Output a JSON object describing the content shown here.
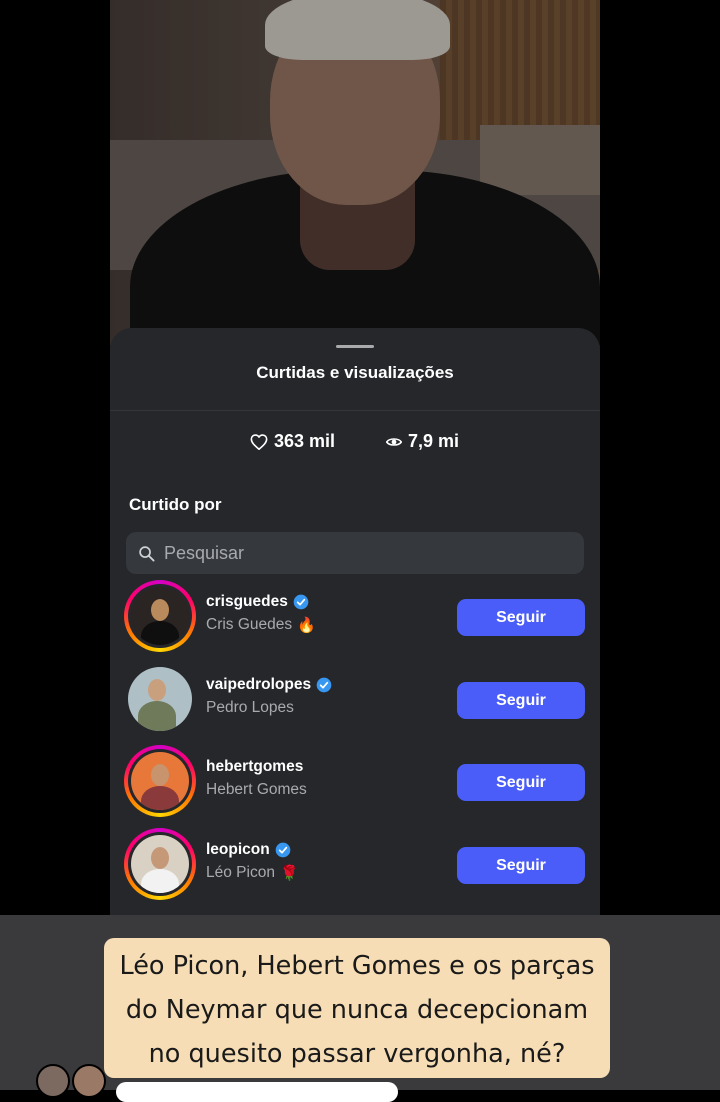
{
  "sheet": {
    "title": "Curtidas e visualizações",
    "likes": "363 mil",
    "views": "7,9 mi",
    "liked_by_label": "Curtido por",
    "search_placeholder": "Pesquisar"
  },
  "users": [
    {
      "username": "crisguedes",
      "name": "Cris Guedes",
      "verified": true,
      "emoji": "🔥",
      "button": "Seguir"
    },
    {
      "username": "vaipedrolopes",
      "name": "Pedro Lopes",
      "verified": true,
      "emoji": "",
      "button": "Seguir"
    },
    {
      "username": "hebertgomes",
      "name": "Hebert Gomes",
      "verified": false,
      "emoji": "",
      "button": "Seguir"
    },
    {
      "username": "leopicon",
      "name": "Léo Picon",
      "verified": true,
      "emoji": "🌹",
      "button": "Seguir"
    }
  ],
  "caption": {
    "line1": "Léo Picon, Hebert Gomes e os parças",
    "line2": "do Neymar que nunca decepcionam",
    "line3": "no quesito passar vergonha, né?"
  },
  "colors": {
    "accent": "#4a5df9",
    "sheet": "#25272b",
    "caption_bg": "#f6ddb5",
    "verified": "#3897f0"
  }
}
